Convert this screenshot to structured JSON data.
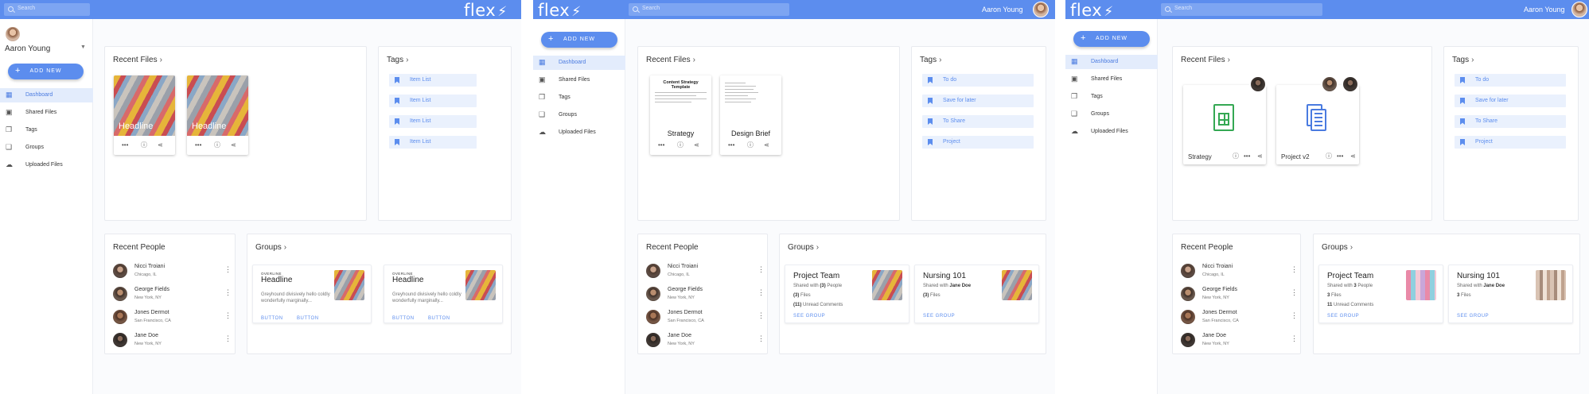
{
  "search": {
    "placeholder": "Search"
  },
  "brand": {
    "logo": "flex"
  },
  "user": {
    "name": "Aaron Young"
  },
  "add_new": "ADD NEW",
  "nav": [
    "Dashboard",
    "Shared Files",
    "Tags",
    "Groups",
    "Uploaded Files"
  ],
  "sections": {
    "recent_files": "Recent Files",
    "tags": "Tags",
    "recent_people": "Recent People",
    "groups": "Groups"
  },
  "people": [
    {
      "name": "Nicci Troiani",
      "location": "Chicago, IL"
    },
    {
      "name": "George Fields",
      "location": "New York, NY"
    },
    {
      "name": "Jones Dermot",
      "location": "San Francisco, CA"
    },
    {
      "name": "Jane Doe",
      "location": "New York, NY"
    }
  ],
  "panel1": {
    "files": [
      {
        "label": "Headline"
      },
      {
        "label": "Headline"
      }
    ],
    "tags": [
      "Item List",
      "Item List",
      "Item List",
      "Item List"
    ],
    "groups": [
      {
        "overline": "OVERLINE",
        "headline": "Headline",
        "body": "Greyhound divisively hello coldly wonderfully marginally...",
        "button1": "BUTTON",
        "button2": "BUTTON"
      },
      {
        "overline": "OVERLINE",
        "headline": "Headline",
        "body": "Greyhound divisively hello coldly wonderfully marginally...",
        "button1": "BUTTON",
        "button2": "BUTTON"
      }
    ]
  },
  "panel2": {
    "files": [
      {
        "name": "Strategy",
        "doc_title": "Content Strategy Template"
      },
      {
        "name": "Design Brief"
      }
    ],
    "tags": [
      "To do",
      "Save for later",
      "To Share",
      "Project"
    ],
    "groups": [
      {
        "name": "Project Team",
        "shared_prefix": "Shared with ",
        "shared_strong": "(3)",
        "shared_suffix": " People",
        "files_strong": "(3)",
        "files_suffix": " Files",
        "comments_strong": "(11)",
        "comments_suffix": " Unread Comments",
        "see": "SEE GROUP"
      },
      {
        "name": "Nursing 101",
        "shared_prefix": "Shared with ",
        "shared_strong": "Jane Doe",
        "shared_suffix": "",
        "files_strong": "(3)",
        "files_suffix": " Files",
        "see": "SEE GROUP"
      }
    ]
  },
  "panel3": {
    "files": [
      {
        "name": "Strategy"
      },
      {
        "name": "Project v2"
      }
    ],
    "tags": [
      "To do",
      "Save for later",
      "To Share",
      "Project"
    ],
    "groups": [
      {
        "name": "Project Team",
        "shared_prefix": "Shared with ",
        "shared_strong": "3",
        "shared_suffix": " People",
        "files_strong": "3",
        "files_suffix": " Files",
        "comments_strong": "11",
        "comments_suffix": " Unread Comments",
        "see": "SEE GROUP"
      },
      {
        "name": "Nursing 101",
        "shared_prefix": "Shared with ",
        "shared_strong": "Jane Doe",
        "shared_suffix": "",
        "files_strong": "3",
        "files_suffix": " Files",
        "see": "SEE GROUP"
      }
    ]
  },
  "colors": {
    "primary": "#5c8dee",
    "active_bg": "#e3ecfc",
    "tag_bg": "#eaf1fd"
  }
}
